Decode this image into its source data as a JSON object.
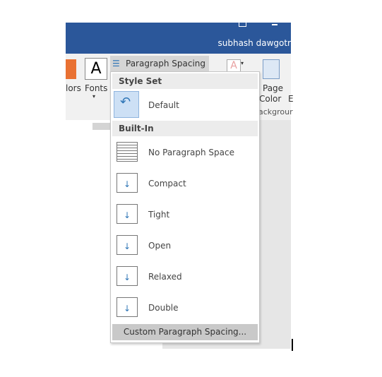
{
  "titlebar": {
    "user_name": "subhash dawgotr"
  },
  "ribbon": {
    "colors_label": "lors",
    "fonts_label": "Fonts",
    "fonts_glyph": "A",
    "paragraph_spacing_label": "Paragraph Spacing",
    "page_color_label_1": "Page",
    "page_color_label_2": "Color",
    "group_label": "ackgrour",
    "partial_label": "E"
  },
  "menu": {
    "style_set_header": "Style Set",
    "default_label": "Default",
    "built_in_header": "Built-In",
    "items": [
      {
        "label": "No Paragraph Space"
      },
      {
        "label": "Compact"
      },
      {
        "label": "Tight"
      },
      {
        "label": "Open"
      },
      {
        "label": "Relaxed"
      },
      {
        "label": "Double"
      }
    ],
    "custom_label": "Custom Paragraph Spacing..."
  },
  "colors": {
    "title_bar": "#2b579a",
    "accent_icon": "#2e75b6"
  }
}
